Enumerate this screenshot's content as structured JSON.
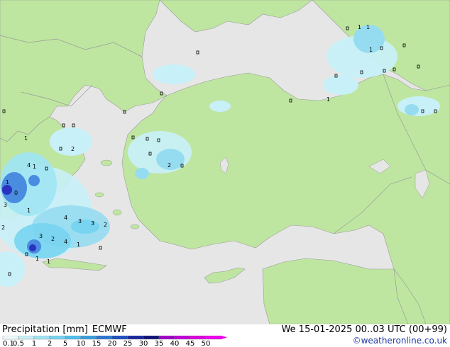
{
  "title": "Precipitation [mm]",
  "model": "ECMWF",
  "valid_time": "We 15-01-2025 00..03 UTC (00+99)",
  "credit": "©weatheronline.co.uk",
  "colors": {
    "sea": "#e6e6e6",
    "land": "#bfe6a0",
    "border": "#9a9a9a",
    "precip_light": "#c8f0f8",
    "precip_mid": "#96dcf0",
    "precip_heavy": "#4a8ce0",
    "precip_max": "#2a32c0"
  },
  "legend": {
    "values": [
      "0.1",
      "0.5",
      "1",
      "2",
      "5",
      "10",
      "15",
      "20",
      "25",
      "30",
      "35",
      "40",
      "45",
      "50"
    ],
    "colors": [
      "#f0fcfe",
      "#c8f0f8",
      "#a0e4f4",
      "#78d4f0",
      "#50c0ec",
      "#3c9ee0",
      "#2c78d4",
      "#2050c0",
      "#1828a0",
      "#101478",
      "#a000c8",
      "#c000d8",
      "#dc00e0",
      "#f000f0"
    ]
  },
  "point_labels": [
    {
      "text": "0",
      "lon": 3
    },
    {
      "text": "1",
      "lon": 3
    },
    {
      "text": "1",
      "lon": 3
    },
    {
      "text": "0",
      "lon": 3
    },
    {
      "text": "0",
      "lon": 3
    }
  ]
}
